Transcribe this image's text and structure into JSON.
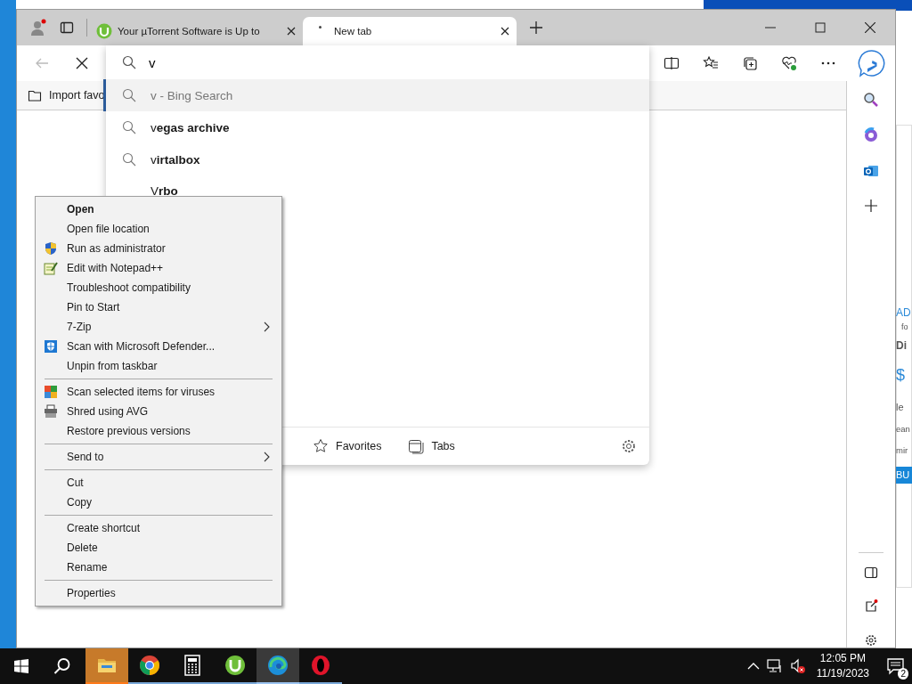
{
  "browser": {
    "tabs": [
      {
        "title": "Your µTorrent Software is Up to",
        "kind": "utorrent",
        "selected": false
      },
      {
        "title": "New tab",
        "kind": "blank",
        "selected": true
      }
    ],
    "address": {
      "value": "v"
    },
    "favorites_bar": {
      "item": "Import favo"
    },
    "suggestions": [
      {
        "kind": "search",
        "text": "v - Bing Search",
        "selected": true
      },
      {
        "kind": "search",
        "text": "v**egas archive**",
        "selected": false
      },
      {
        "kind": "search",
        "text": "v**irtalbox**",
        "selected": false
      },
      {
        "kind": "site",
        "text": "V**rbo**",
        "selected": false
      }
    ],
    "dropdown_footer": [
      {
        "kind": "star",
        "label": "Favorites"
      },
      {
        "kind": "tabs",
        "label": "Tabs"
      }
    ]
  },
  "background_page": {
    "texts": [
      "AD",
      "fo",
      "Di",
      "$",
      "le",
      "ean",
      "mir",
      "BU"
    ]
  },
  "context_menu": {
    "groups": [
      [
        {
          "label": "Open",
          "bold": true,
          "kind": "plain",
          "submenu": false
        },
        {
          "label": "Open file location",
          "bold": false,
          "kind": "plain",
          "submenu": false
        },
        {
          "label": "Run as administrator",
          "bold": false,
          "kind": "shield",
          "submenu": false
        },
        {
          "label": "Edit with Notepad++",
          "bold": false,
          "kind": "notepad",
          "submenu": false
        },
        {
          "label": "Troubleshoot compatibility",
          "bold": false,
          "kind": "plain",
          "submenu": false
        },
        {
          "label": "Pin to Start",
          "bold": false,
          "kind": "plain",
          "submenu": false
        },
        {
          "label": "7-Zip",
          "bold": false,
          "kind": "plain",
          "submenu": true
        },
        {
          "label": "Scan with Microsoft Defender...",
          "bold": false,
          "kind": "defender",
          "submenu": false
        },
        {
          "label": "Unpin from taskbar",
          "bold": false,
          "kind": "plain",
          "submenu": false
        }
      ],
      [
        {
          "label": "Scan selected items for viruses",
          "bold": false,
          "kind": "avg",
          "submenu": false
        },
        {
          "label": "Shred using AVG",
          "bold": false,
          "kind": "shredder",
          "submenu": false
        },
        {
          "label": "Restore previous versions",
          "bold": false,
          "kind": "plain",
          "submenu": false
        }
      ],
      [
        {
          "label": "Send to",
          "bold": false,
          "kind": "plain",
          "submenu": true
        }
      ],
      [
        {
          "label": "Cut",
          "bold": false,
          "kind": "plain",
          "submenu": false
        },
        {
          "label": "Copy",
          "bold": false,
          "kind": "plain",
          "submenu": false
        }
      ],
      [
        {
          "label": "Create shortcut",
          "bold": false,
          "kind": "plain",
          "submenu": false
        },
        {
          "label": "Delete",
          "bold": false,
          "kind": "plain",
          "submenu": false
        },
        {
          "label": "Rename",
          "bold": false,
          "kind": "plain",
          "submenu": false
        }
      ],
      [
        {
          "label": "Properties",
          "bold": false,
          "kind": "plain",
          "submenu": false
        }
      ]
    ]
  },
  "taskbar": {
    "apps": [
      {
        "kind": "explorer",
        "selected": false,
        "flashing": true
      },
      {
        "kind": "chrome",
        "selected": false,
        "flashing": false
      },
      {
        "kind": "calculator",
        "selected": false,
        "flashing": false
      },
      {
        "kind": "utorrent",
        "selected": false,
        "flashing": false
      },
      {
        "kind": "edge",
        "selected": true,
        "flashing": false
      },
      {
        "kind": "opera",
        "selected": false,
        "flashing": false
      }
    ],
    "time": "12:05 PM",
    "date": "11/19/2023",
    "notifications": "2"
  }
}
